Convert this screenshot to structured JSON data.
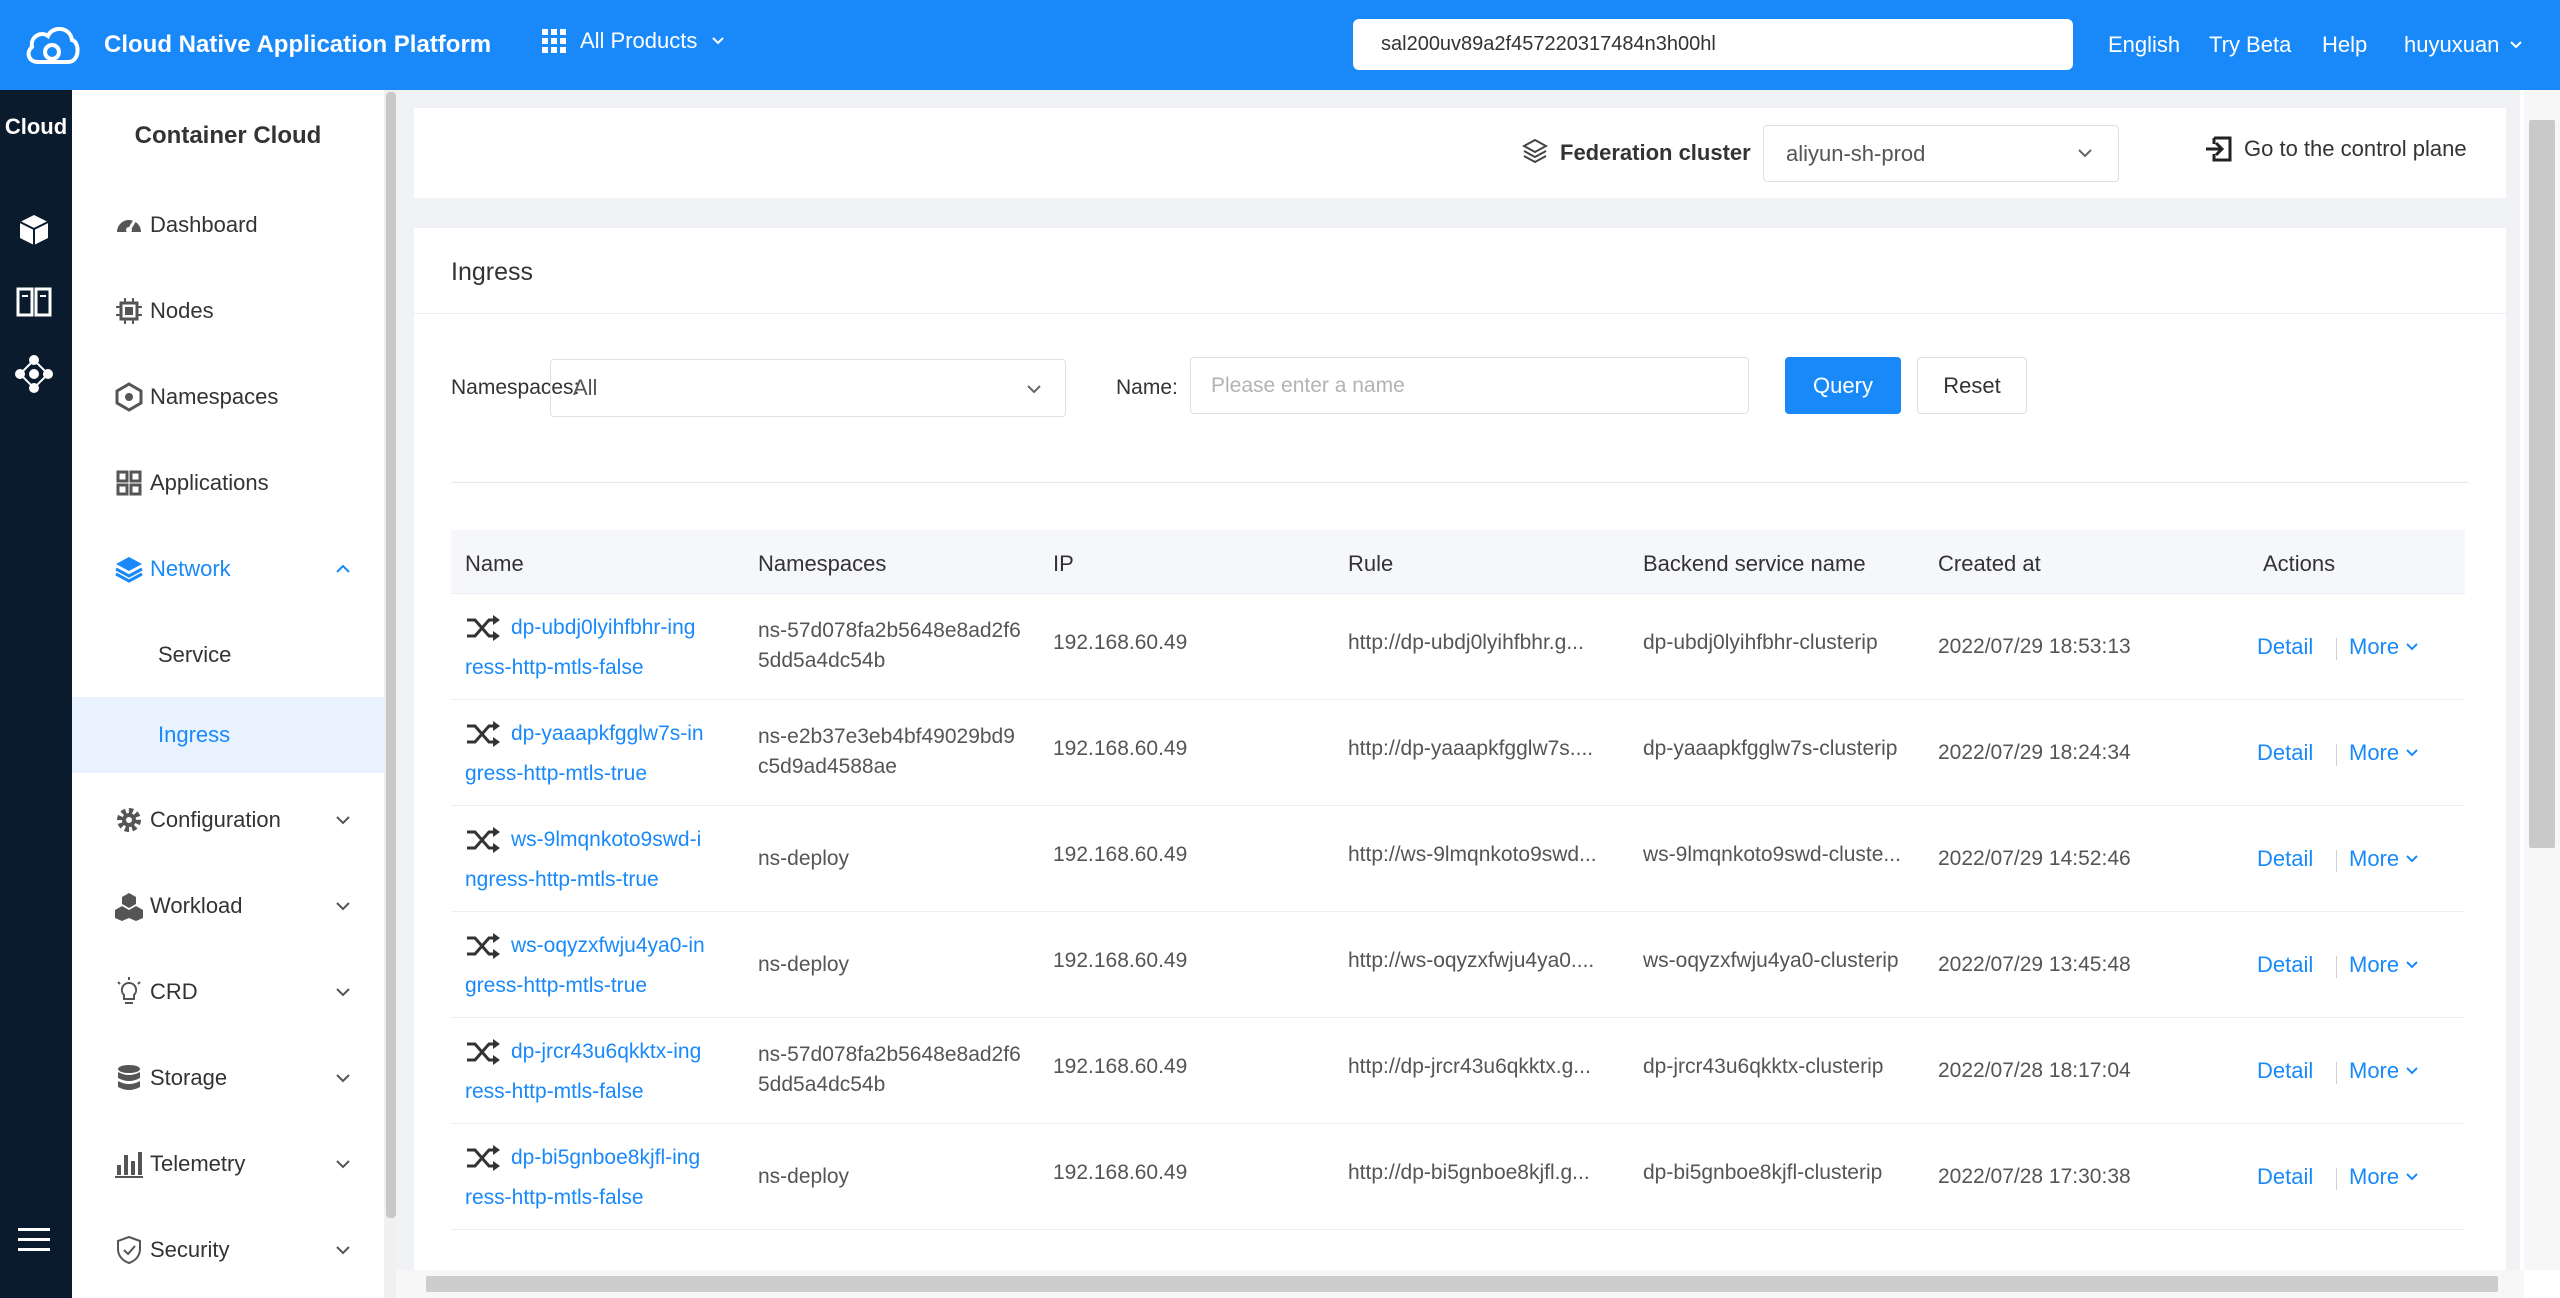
{
  "topbar": {
    "title": "Cloud Native Application Platform",
    "products_label": "All Products",
    "search_value": "sal200uv89a2f457220317484n3h00hl",
    "links": [
      "English",
      "Try Beta",
      "Help",
      "huyuxuan"
    ],
    "color": "#1989fa"
  },
  "rail": {
    "title": "Cloud",
    "icons": [
      "cube-icon",
      "columns-icon",
      "cluster-icon",
      "menu-icon"
    ]
  },
  "sidebar": {
    "heading": "Container Cloud",
    "items": [
      {
        "label": "Dashboard",
        "icon": "dashboard-icon"
      },
      {
        "label": "Nodes",
        "icon": "chip-icon"
      },
      {
        "label": "Namespaces",
        "icon": "namespace-icon"
      },
      {
        "label": "Applications",
        "icon": "grid-icon"
      },
      {
        "label": "Network",
        "icon": "layers-icon",
        "expanded": true
      },
      {
        "label": "Configuration",
        "icon": "gear-icon"
      },
      {
        "label": "Workload",
        "icon": "cubes-icon"
      },
      {
        "label": "CRD",
        "icon": "bulb-icon"
      },
      {
        "label": "Storage",
        "icon": "database-icon"
      },
      {
        "label": "Telemetry",
        "icon": "bar-chart-icon"
      },
      {
        "label": "Security",
        "icon": "shield-icon"
      }
    ],
    "network_sub": [
      {
        "label": "Service"
      },
      {
        "label": "Ingress",
        "active": true
      }
    ]
  },
  "federation": {
    "label": "Federation cluster",
    "selected": "aliyun-sh-prod",
    "control_plane": "Go to the control plane"
  },
  "main": {
    "title": "Ingress",
    "filters": {
      "namespaces_label": "Namespaces",
      "namespaces_value": "All",
      "name_label": "Name",
      "name_placeholder": "Please enter a name",
      "query": "Query",
      "reset": "Reset"
    },
    "table": {
      "columns": [
        "Name",
        "Namespaces",
        "IP",
        "Rule",
        "Backend service name",
        "Created at",
        "Actions"
      ],
      "rows": [
        {
          "name1": "dp-ubdj0lyihfbhr-ing",
          "name2": "ress-http-mtls-false",
          "ns1": "ns-57d078fa2b5648e8ad2f6",
          "ns2": "5dd5a4dc54b",
          "ip": "192.168.60.49",
          "rule": "http://dp-ubdj0lyihfbhr.g...",
          "backend": "dp-ubdj0lyihfbhr-clusterip",
          "created": "2022/07/29 18:53:13"
        },
        {
          "name1": "dp-yaaapkfgglw7s-in",
          "name2": "gress-http-mtls-true",
          "ns1": "ns-e2b37e3eb4bf49029bd9",
          "ns2": "c5d9ad4588ae",
          "ip": "192.168.60.49",
          "rule": "http://dp-yaaapkfgglw7s....",
          "backend": "dp-yaaapkfgglw7s-clusterip",
          "created": "2022/07/29 18:24:34"
        },
        {
          "name1": "ws-9lmqnkoto9swd-i",
          "name2": "ngress-http-mtls-true",
          "ns1": "ns-deploy",
          "ns2": "",
          "ip": "192.168.60.49",
          "rule": "http://ws-9lmqnkoto9swd...",
          "backend": "ws-9lmqnkoto9swd-cluste...",
          "created": "2022/07/29 14:52:46"
        },
        {
          "name1": "ws-oqyzxfwju4ya0-in",
          "name2": "gress-http-mtls-true",
          "ns1": "ns-deploy",
          "ns2": "",
          "ip": "192.168.60.49",
          "rule": "http://ws-oqyzxfwju4ya0....",
          "backend": "ws-oqyzxfwju4ya0-clusterip",
          "created": "2022/07/29 13:45:48"
        },
        {
          "name1": "dp-jrcr43u6qkktx-ing",
          "name2": "ress-http-mtls-false",
          "ns1": "ns-57d078fa2b5648e8ad2f6",
          "ns2": "5dd5a4dc54b",
          "ip": "192.168.60.49",
          "rule": "http://dp-jrcr43u6qkktx.g...",
          "backend": "dp-jrcr43u6qkktx-clusterip",
          "created": "2022/07/28 18:17:04"
        },
        {
          "name1": "dp-bi5gnboe8kjfl-ing",
          "name2": "ress-http-mtls-false",
          "ns1": "ns-deploy",
          "ns2": "",
          "ip": "192.168.60.49",
          "rule": "http://dp-bi5gnboe8kjfl.g...",
          "backend": "dp-bi5gnboe8kjfl-clusterip",
          "created": "2022/07/28 17:30:38"
        }
      ],
      "actions": {
        "detail": "Detail",
        "more": "More"
      }
    }
  }
}
